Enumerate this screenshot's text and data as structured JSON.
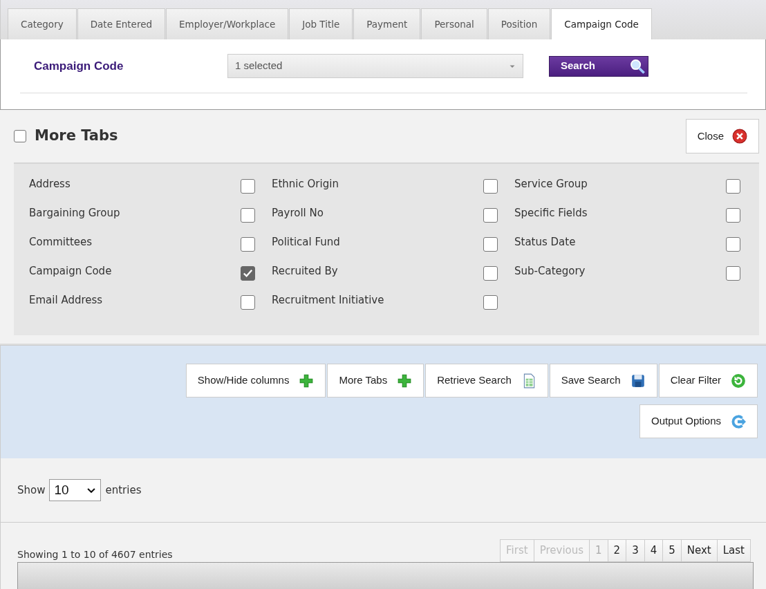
{
  "tabs": [
    {
      "label": "Category",
      "selected": false
    },
    {
      "label": "Date Entered",
      "selected": false
    },
    {
      "label": "Employer/Workplace",
      "selected": false
    },
    {
      "label": "Job Title",
      "selected": false
    },
    {
      "label": "Payment",
      "selected": false
    },
    {
      "label": "Personal",
      "selected": false
    },
    {
      "label": "Position",
      "selected": false
    },
    {
      "label": "Campaign Code",
      "selected": true
    }
  ],
  "filter": {
    "label": "Campaign Code",
    "value": "1 selected",
    "search_button": "Search"
  },
  "more_tabs": {
    "title": "More Tabs",
    "checked": false,
    "close_button": "Close",
    "columns": [
      [
        {
          "label": "Address",
          "checked": false
        },
        {
          "label": "Bargaining Group",
          "checked": false
        },
        {
          "label": "Committees",
          "checked": false
        },
        {
          "label": "Campaign Code",
          "checked": true
        },
        {
          "label": "Email Address",
          "checked": false
        }
      ],
      [
        {
          "label": "Ethnic Origin",
          "checked": false
        },
        {
          "label": "Payroll No",
          "checked": false
        },
        {
          "label": "Political Fund",
          "checked": false
        },
        {
          "label": "Recruited By",
          "checked": false
        },
        {
          "label": "Recruitment Initiative",
          "checked": false
        }
      ],
      [
        {
          "label": "Service Group",
          "checked": false
        },
        {
          "label": "Specific Fields",
          "checked": false
        },
        {
          "label": "Status Date",
          "checked": false
        },
        {
          "label": "Sub-Category",
          "checked": false
        }
      ]
    ]
  },
  "toolbar": [
    {
      "label": "Show/Hide columns",
      "kind": "plus"
    },
    {
      "label": "More Tabs",
      "kind": "plus"
    },
    {
      "label": "Retrieve Search",
      "kind": "sheet"
    },
    {
      "label": "Save Search",
      "kind": "save"
    },
    {
      "label": "Clear Filter",
      "kind": "reset"
    },
    {
      "label": "Output Options",
      "kind": "export"
    }
  ],
  "length": {
    "before": "Show",
    "value": "10",
    "after": "entries"
  },
  "info": "Showing 1 to 10 of 4607 entries",
  "pager": [
    {
      "label": "First",
      "disabled": true,
      "selected": false
    },
    {
      "label": "Previous",
      "disabled": true,
      "selected": false
    },
    {
      "label": "1",
      "disabled": false,
      "selected": true
    },
    {
      "label": "2",
      "disabled": false,
      "selected": false
    },
    {
      "label": "3",
      "disabled": false,
      "selected": false
    },
    {
      "label": "4",
      "disabled": false,
      "selected": false
    },
    {
      "label": "5",
      "disabled": false,
      "selected": false
    },
    {
      "label": "Next",
      "disabled": false,
      "selected": false
    },
    {
      "label": "Last",
      "disabled": false,
      "selected": false
    }
  ]
}
